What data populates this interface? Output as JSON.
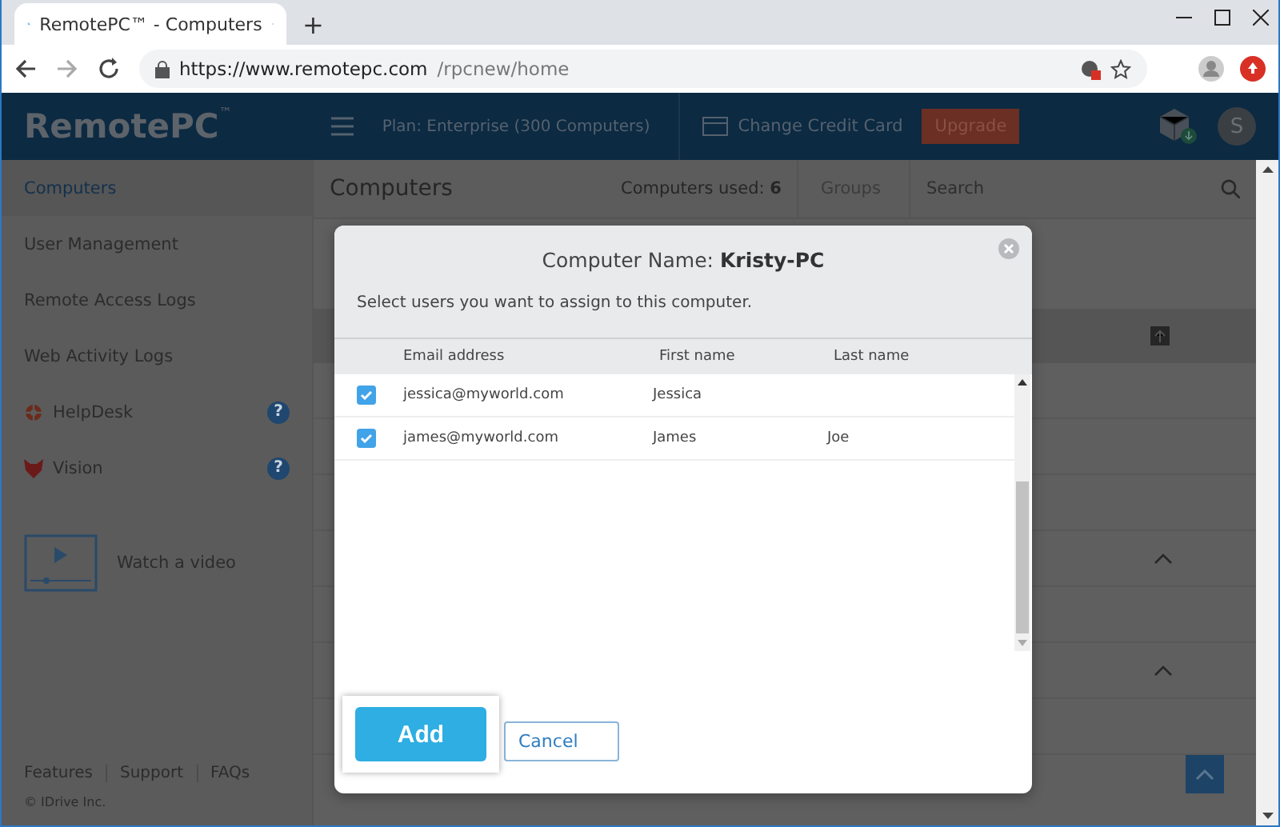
{
  "browser": {
    "tab_title": "RemotePC™ - Computers",
    "new_tab": "+",
    "url_host": "https://www.remotepc.com",
    "url_path": "/rpcnew/home"
  },
  "header": {
    "logo": "RemotePC",
    "logo_mark": "™",
    "plan": "Plan: Enterprise (300 Computers)",
    "change_card": "Change Credit Card",
    "upgrade": "Upgrade",
    "avatar": "S"
  },
  "sidebar": {
    "items": [
      {
        "label": "Computers",
        "selected": true,
        "kind": "plain"
      },
      {
        "label": "User Management",
        "selected": false,
        "kind": "plain"
      },
      {
        "label": "Remote Access Logs",
        "selected": false,
        "kind": "plain"
      },
      {
        "label": "Web Activity Logs",
        "selected": false,
        "kind": "plain"
      },
      {
        "label": "HelpDesk",
        "selected": false,
        "kind": "helpdesk",
        "help": "?"
      },
      {
        "label": "Vision",
        "selected": false,
        "kind": "vision",
        "help": "?"
      }
    ],
    "video": "Watch a video",
    "footer_links": [
      "Features",
      "Support",
      "FAQs"
    ],
    "copyright": "© IDrive Inc."
  },
  "main": {
    "title": "Computers",
    "used_label": "Computers used:",
    "used_count": "6",
    "groups": "Groups",
    "search": {
      "placeholder": "Search"
    }
  },
  "dialog": {
    "title_label": "Computer Name:",
    "computer_name": "Kristy-PC",
    "instruction": "Select users you want to assign to this computer.",
    "columns": [
      "Email address",
      "First name",
      "Last name"
    ],
    "rows": [
      {
        "email": "jessica@myworld.com",
        "first_name": "Jessica",
        "checked": true
      },
      {
        "email": "james@myworld.com",
        "first_name": "James",
        "last_name": "Joe",
        "checked": true
      }
    ],
    "buttons": [
      {
        "label": "Add",
        "kind": "primary"
      },
      {
        "label": "Cancel",
        "kind": "secondary"
      }
    ]
  }
}
